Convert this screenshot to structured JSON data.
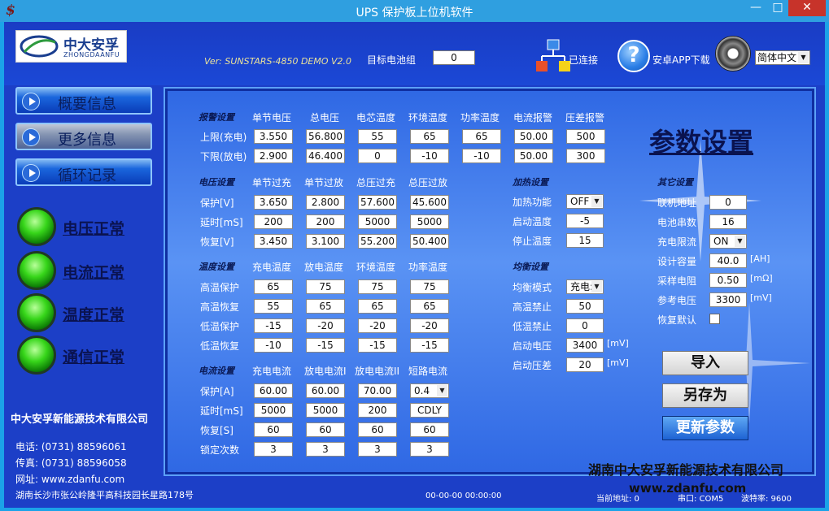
{
  "window": {
    "title": "UPS 保护板上位机软件",
    "min": "—",
    "max": "□",
    "close": "✕"
  },
  "header": {
    "logo_cn": "中大安孚",
    "logo_en": "ZHONGDAANFU",
    "version": "Ver: SUNSTARS-4850 DEMO V2.0",
    "target_label": "目标电池组",
    "target_value": "0",
    "connected_label": "已连接",
    "app_download_label": "安卓APP下载",
    "language": "简体中文"
  },
  "nav": {
    "overview": "概要信息",
    "more": "更多信息",
    "cycle": "循环记录"
  },
  "status": {
    "voltage": "电压正常",
    "current": "电流正常",
    "temperature": "温度正常",
    "comm": "通信正常"
  },
  "company": {
    "name": "中大安孚新能源技术有限公司",
    "phone": "电话: (0731) 88596061",
    "fax": "传真: (0731) 88596058",
    "web": "网址: www.zdanfu.com",
    "address": "湖南长沙市张公岭隆平高科技园长星路178号"
  },
  "alarm": {
    "section": "报警设置",
    "cols": [
      "单节电压",
      "总电压",
      "电芯温度",
      "环境温度",
      "功率温度",
      "电流报警",
      "压差报警"
    ],
    "rows": [
      {
        "label": "上限(充电)",
        "values": [
          "3.550",
          "56.800",
          "55",
          "65",
          "65",
          "50.00",
          "500"
        ]
      },
      {
        "label": "下限(放电)",
        "values": [
          "2.900",
          "46.400",
          "0",
          "-10",
          "-10",
          "50.00",
          "300"
        ]
      }
    ]
  },
  "voltage": {
    "section": "电压设置",
    "cols": [
      "单节过充",
      "单节过放",
      "总压过充",
      "总压过放"
    ],
    "rows": [
      {
        "label": "保护[V]",
        "values": [
          "3.650",
          "2.800",
          "57.600",
          "45.600"
        ]
      },
      {
        "label": "延时[mS]",
        "values": [
          "200",
          "200",
          "5000",
          "5000"
        ]
      },
      {
        "label": "恢复[V]",
        "values": [
          "3.450",
          "3.100",
          "55.200",
          "50.400"
        ]
      }
    ]
  },
  "temperature": {
    "section": "温度设置",
    "cols": [
      "充电温度",
      "放电温度",
      "环境温度",
      "功率温度"
    ],
    "rows": [
      {
        "label": "高温保护",
        "values": [
          "65",
          "75",
          "75",
          "75"
        ]
      },
      {
        "label": "高温恢复",
        "values": [
          "55",
          "65",
          "65",
          "65"
        ]
      },
      {
        "label": "低温保护",
        "values": [
          "-15",
          "-20",
          "-20",
          "-20"
        ]
      },
      {
        "label": "低温恢复",
        "values": [
          "-10",
          "-15",
          "-15",
          "-15"
        ]
      }
    ]
  },
  "current": {
    "section": "电流设置",
    "cols": [
      "充电电流",
      "放电电流I",
      "放电电流II",
      "短路电流"
    ],
    "rows": [
      {
        "label": "保护[A]",
        "values": [
          "60.00",
          "60.00",
          "70.00",
          "0.4"
        ]
      },
      {
        "label": "延时[mS]",
        "values": [
          "5000",
          "5000",
          "200",
          "CDLY"
        ]
      },
      {
        "label": "恢复[S]",
        "values": [
          "60",
          "60",
          "60",
          "60"
        ]
      },
      {
        "label": "锁定次数",
        "values": [
          "3",
          "3",
          "3",
          "3"
        ]
      }
    ]
  },
  "heating": {
    "section": "加热设置",
    "function_label": "加热功能",
    "function_value": "OFF",
    "start_label": "启动温度",
    "start_value": "-5",
    "stop_label": "停止温度",
    "stop_value": "15"
  },
  "balance": {
    "section": "均衡设置",
    "mode_label": "均衡模式",
    "mode_value": "充电:",
    "high_label": "高温禁止",
    "high_value": "50",
    "low_label": "低温禁止",
    "low_value": "0",
    "start_v_label": "启动电压",
    "start_v_value": "3400",
    "diff_label": "启动压差",
    "diff_value": "20",
    "unit_mv": "[mV]"
  },
  "other": {
    "section": "其它设置",
    "addr_label": "联机地址",
    "addr_value": "0",
    "series_label": "电池串数",
    "series_value": "16",
    "limit_label": "充电限流",
    "limit_value": "ON",
    "cap_label": "设计容量",
    "cap_value": "40.0",
    "cap_unit": "[AH]",
    "res_label": "采样电阻",
    "res_value": "0.50",
    "res_unit": "[mΩ]",
    "ref_label": "参考电压",
    "ref_value": "3300",
    "ref_unit": "[mV]",
    "restore_label": "恢复默认"
  },
  "main": {
    "title": "参数设置"
  },
  "buttons": {
    "import": "导入",
    "save_as": "另存为",
    "update": "更新参数"
  },
  "footer": {
    "company": "湖南中大安孚新能源技术有限公司",
    "website": "www.zdanfu.com"
  },
  "statusbar": {
    "time": "00-00-00 00:00:00",
    "address": "当前地址: 0",
    "port": "串口: COM5",
    "baud": "波特率: 9600"
  }
}
